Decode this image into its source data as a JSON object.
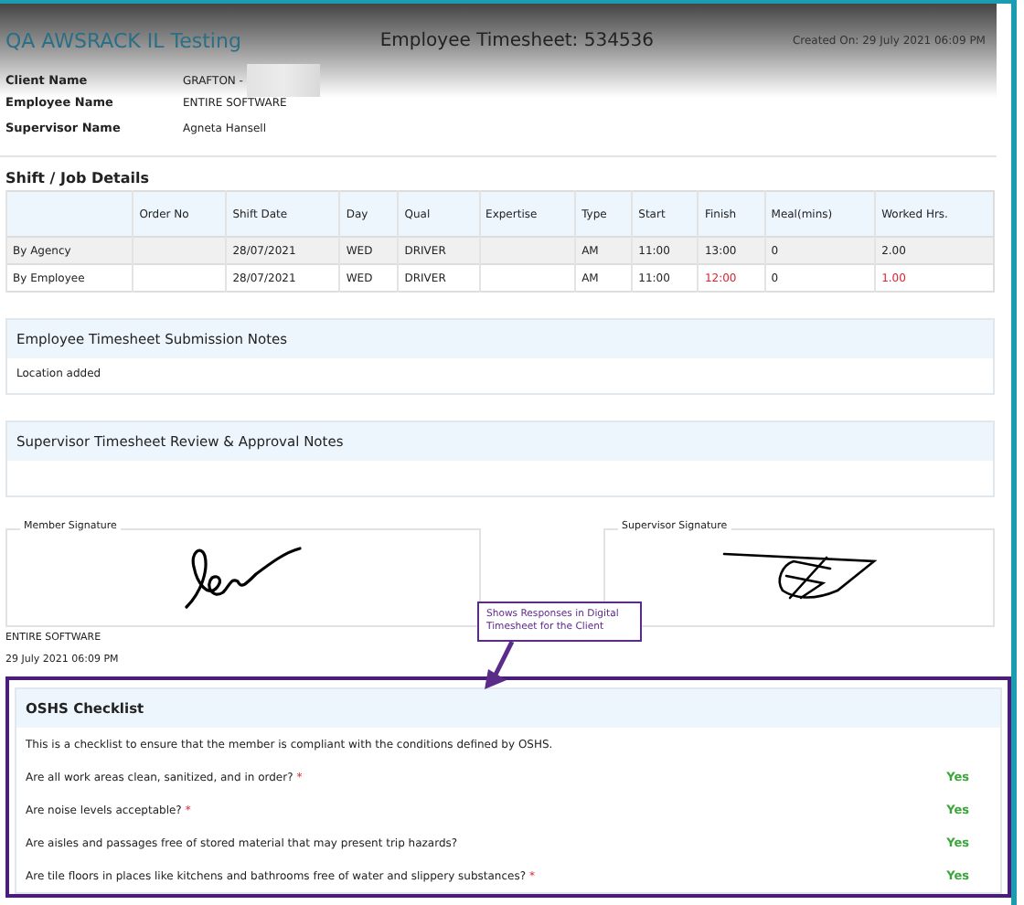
{
  "header": {
    "org": "QA AWSRACK IL Testing",
    "title": "Employee Timesheet: 534536",
    "created": "Created On: 29 July 2021 06:09 PM"
  },
  "info": [
    {
      "label": "Client Name",
      "value": "GRAFTON -",
      "redacted": true
    },
    {
      "label": "Employee Name",
      "value": "ENTIRE SOFTWARE"
    },
    {
      "label": "Supervisor Name",
      "value": "Agneta Hansell"
    }
  ],
  "shift": {
    "title": "Shift / Job Details",
    "columns": [
      "",
      "Order No",
      "Shift Date",
      "Day",
      "Qual",
      "Expertise",
      "Type",
      "Start",
      "Finish",
      "Meal(mins)",
      "Worked Hrs."
    ],
    "rows": [
      {
        "shaded": true,
        "cells": [
          {
            "text": "By Agency",
            "alert": false
          },
          {
            "text": ""
          },
          {
            "text": "28/07/2021",
            "alert": false
          },
          {
            "text": "WED",
            "alert": false
          },
          {
            "text": "DRIVER",
            "alert": false
          },
          {
            "text": ""
          },
          {
            "text": "AM",
            "alert": false
          },
          {
            "text": "11:00",
            "alert": false
          },
          {
            "text": "13:00",
            "alert": false
          },
          {
            "text": "0",
            "alert": false
          },
          {
            "text": "2.00",
            "alert": false
          }
        ]
      },
      {
        "shaded": false,
        "cells": [
          {
            "text": "By Employee",
            "alert": false
          },
          {
            "text": ""
          },
          {
            "text": "28/07/2021",
            "alert": false
          },
          {
            "text": "WED",
            "alert": false
          },
          {
            "text": "DRIVER",
            "alert": false
          },
          {
            "text": ""
          },
          {
            "text": "AM",
            "alert": false
          },
          {
            "text": "11:00",
            "alert": false
          },
          {
            "text": "12:00",
            "alert": true
          },
          {
            "text": "0",
            "alert": false
          },
          {
            "text": "1.00",
            "alert": true
          }
        ]
      }
    ]
  },
  "notes": [
    {
      "title": "Employee Timesheet Submission Notes",
      "body": "Location added"
    },
    {
      "title": "Supervisor Timesheet Review & Approval Notes"
    }
  ],
  "signatures": {
    "member_label": "Member Signature",
    "supervisor_label": "Supervisor Signature",
    "member_name": "ENTIRE SOFTWARE",
    "member_date": "29 July 2021 06:09 PM"
  },
  "callout": "Shows Responses in Digital Timesheet for the Client",
  "checklist": {
    "title": "OSHS Checklist",
    "intro": "This is a checklist to ensure that the member is compliant with the conditions defined by OSHS.",
    "items": [
      {
        "question": "Are all work areas clean, sanitized, and in order?",
        "mark": "*",
        "answer": "Yes"
      },
      {
        "question": "Are noise levels acceptable?",
        "mark": "*",
        "answer": "Yes"
      },
      {
        "question": "Are aisles and passages free of stored material that may present trip hazards?",
        "answer": "Yes"
      },
      {
        "question": "Are tile floors in places like kitchens and bathrooms free of water and slippery substances?",
        "mark": "*",
        "answer": "Yes"
      }
    ]
  }
}
